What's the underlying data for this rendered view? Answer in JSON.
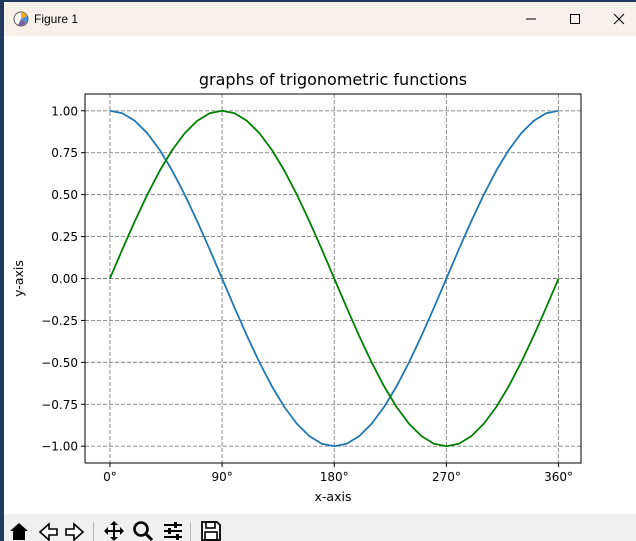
{
  "window": {
    "title": "Figure 1",
    "controls": [
      "minimize",
      "maximize",
      "close"
    ]
  },
  "toolbar": {
    "buttons": [
      "home-icon",
      "back-icon",
      "forward-icon",
      "pan-icon",
      "zoom-icon",
      "configure-subplots-icon",
      "save-icon"
    ]
  },
  "colors": {
    "cos_line": "#1f77b4",
    "sin_line": "#008000",
    "grid": "#808080",
    "titlebar": "#f7f2e9",
    "toolbar": "#f0f0f0"
  },
  "chart_data": {
    "type": "line",
    "title": "graphs of trigonometric functions",
    "xlabel": "x-axis",
    "ylabel": "y-axis",
    "xlim": [
      -20,
      378
    ],
    "ylim": [
      -1.1,
      1.1
    ],
    "grid": true,
    "grid_style": "dashed",
    "xticks": [
      0,
      90,
      180,
      270,
      360
    ],
    "xtick_labels": [
      "0°",
      "90°",
      "180°",
      "270°",
      "360°"
    ],
    "yticks": [
      1.0,
      0.75,
      0.5,
      0.25,
      0.0,
      -0.25,
      -0.5,
      -0.75,
      -1.0
    ],
    "ytick_labels": [
      "1.00",
      "0.75",
      "0.50",
      "0.25",
      "0.00",
      "−0.25",
      "−0.50",
      "−0.75",
      "−1.00"
    ],
    "x": [
      0,
      10,
      20,
      30,
      40,
      50,
      60,
      70,
      80,
      90,
      100,
      110,
      120,
      130,
      140,
      150,
      160,
      170,
      180,
      190,
      200,
      210,
      220,
      230,
      240,
      250,
      260,
      270,
      280,
      290,
      300,
      310,
      320,
      330,
      340,
      350,
      360
    ],
    "series": [
      {
        "color": "#1f77b4",
        "values": [
          1.0,
          0.985,
          0.94,
          0.866,
          0.766,
          0.643,
          0.5,
          0.342,
          0.174,
          0.0,
          -0.174,
          -0.342,
          -0.5,
          -0.643,
          -0.766,
          -0.866,
          -0.94,
          -0.985,
          -1.0,
          -0.985,
          -0.94,
          -0.866,
          -0.766,
          -0.643,
          -0.5,
          -0.342,
          -0.174,
          0.0,
          0.174,
          0.342,
          0.5,
          0.643,
          0.766,
          0.866,
          0.94,
          0.985,
          1.0
        ]
      },
      {
        "color": "#008000",
        "values": [
          0.0,
          0.174,
          0.342,
          0.5,
          0.643,
          0.766,
          0.866,
          0.94,
          0.985,
          1.0,
          0.985,
          0.94,
          0.866,
          0.766,
          0.643,
          0.5,
          0.342,
          0.174,
          0.0,
          -0.174,
          -0.342,
          -0.5,
          -0.643,
          -0.766,
          -0.866,
          -0.94,
          -0.985,
          -1.0,
          -0.985,
          -0.94,
          -0.866,
          -0.766,
          -0.643,
          -0.5,
          -0.342,
          -0.174,
          0.0
        ]
      }
    ]
  }
}
